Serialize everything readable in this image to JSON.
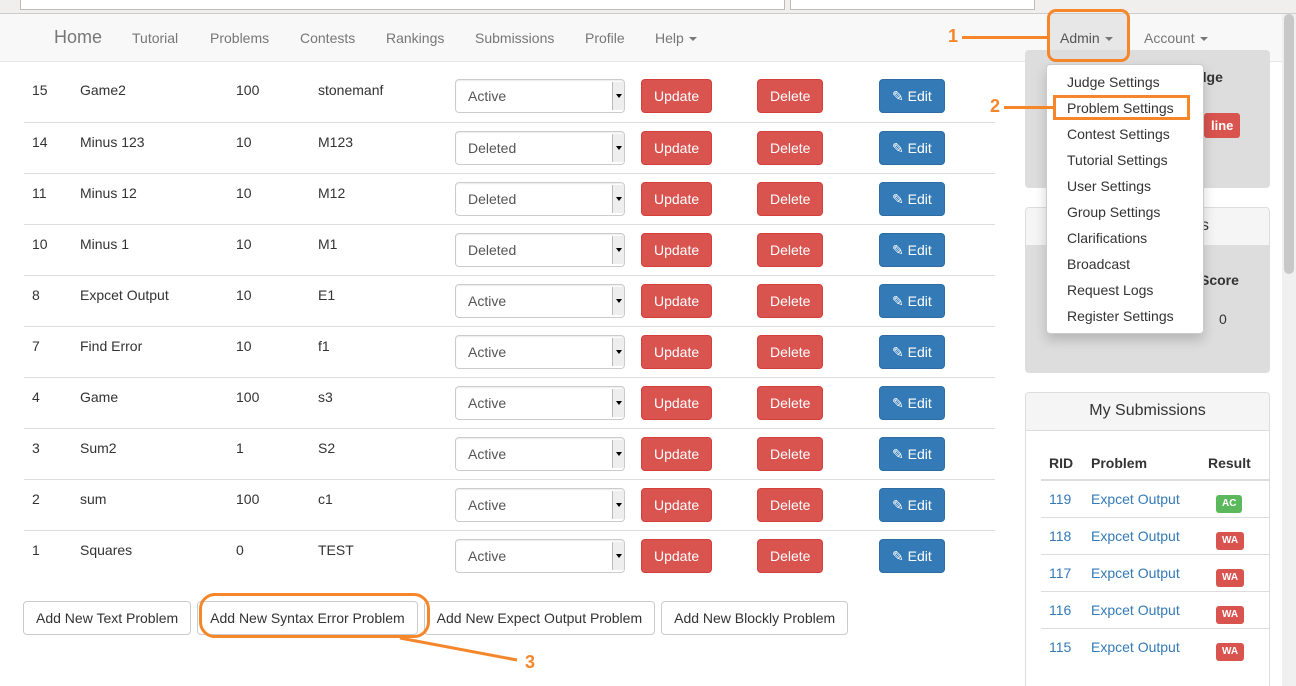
{
  "nav": {
    "brand": "Home",
    "items": [
      "Tutorial",
      "Problems",
      "Contests",
      "Rankings",
      "Submissions",
      "Profile",
      "Help"
    ],
    "admin": "Admin",
    "account": "Account"
  },
  "problems": [
    {
      "id": "15",
      "title": "Game2",
      "score": "100",
      "code": "stonemanf",
      "status": "Active"
    },
    {
      "id": "14",
      "title": "Minus 123",
      "score": "10",
      "code": "M123",
      "status": "Deleted"
    },
    {
      "id": "11",
      "title": "Minus 12",
      "score": "10",
      "code": "M12",
      "status": "Deleted"
    },
    {
      "id": "10",
      "title": "Minus 1",
      "score": "10",
      "code": "M1",
      "status": "Deleted"
    },
    {
      "id": "8",
      "title": "Expcet Output",
      "score": "10",
      "code": "E1",
      "status": "Active"
    },
    {
      "id": "7",
      "title": "Find Error",
      "score": "10",
      "code": "f1",
      "status": "Active"
    },
    {
      "id": "4",
      "title": "Game",
      "score": "100",
      "code": "s3",
      "status": "Active"
    },
    {
      "id": "3",
      "title": "Sum2",
      "score": "1",
      "code": "S2",
      "status": "Active"
    },
    {
      "id": "2",
      "title": "sum",
      "score": "100",
      "code": "c1",
      "status": "Active"
    },
    {
      "id": "1",
      "title": "Squares",
      "score": "0",
      "code": "TEST",
      "status": "Active"
    }
  ],
  "row_actions": {
    "update": "Update",
    "delete": "Delete",
    "edit": "Edit"
  },
  "add_buttons": [
    "Add New Text Problem",
    "Add New Syntax Error Problem",
    "Add New Expect Output Problem",
    "Add New Blockly Problem"
  ],
  "admin_menu": [
    "Judge Settings",
    "Problem Settings",
    "Contest Settings",
    "Tutorial Settings",
    "User Settings",
    "Group Settings",
    "Clarifications",
    "Broadcast",
    "Request Logs",
    "Register Settings"
  ],
  "sidebar": {
    "panel1_partial": "dge",
    "badge_partial": "line",
    "panel2_header_partial": "s",
    "panel2_col": "Score",
    "panel2_val": "0",
    "submissions": {
      "title": "My Submissions",
      "headers": [
        "RID",
        "Problem",
        "Result"
      ],
      "rows": [
        {
          "rid": "119",
          "problem": "Expcet Output",
          "result": "AC"
        },
        {
          "rid": "118",
          "problem": "Expcet Output",
          "result": "WA"
        },
        {
          "rid": "117",
          "problem": "Expcet Output",
          "result": "WA"
        },
        {
          "rid": "116",
          "problem": "Expcet Output",
          "result": "WA"
        },
        {
          "rid": "115",
          "problem": "Expcet Output",
          "result": "WA"
        }
      ]
    }
  },
  "annotations": [
    "1",
    "2",
    "3"
  ],
  "colors": {
    "annotation": "#f5862a",
    "danger": "#d9534f",
    "primary": "#337ab7",
    "success": "#5cb85c"
  }
}
